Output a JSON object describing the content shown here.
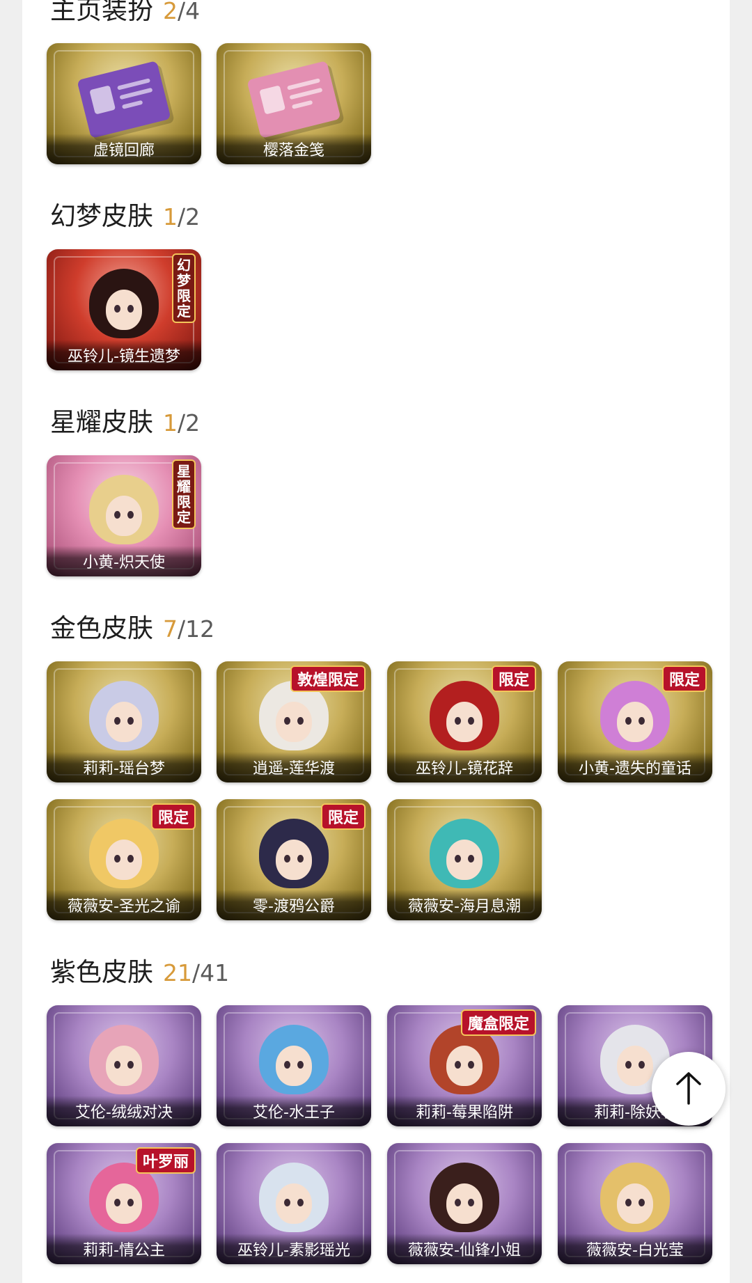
{
  "sections": [
    {
      "title": "主页装扮",
      "owned": "2",
      "separator": "/",
      "total": "4",
      "items": [
        {
          "label": "虚镜回廊",
          "theme": "gold",
          "art": "ticket",
          "art_color": "#7b4db8"
        },
        {
          "label": "樱落金笺",
          "theme": "gold",
          "art": "ticket",
          "art_color": "#e38fb2"
        }
      ]
    },
    {
      "title": "幻梦皮肤",
      "owned": "1",
      "separator": "/",
      "total": "2",
      "items": [
        {
          "label": "巫铃儿-镜生遗梦",
          "theme": "red",
          "art": "portrait",
          "hair_color": "#2a1412",
          "badge": "幻梦限定",
          "badge_style": "vertical"
        }
      ]
    },
    {
      "title": "星耀皮肤",
      "owned": "1",
      "separator": "/",
      "total": "2",
      "items": [
        {
          "label": "小黄-炽天使",
          "theme": "pink",
          "art": "portrait",
          "hair_color": "#e8cf8c",
          "badge": "星耀限定",
          "badge_style": "vertical"
        }
      ]
    },
    {
      "title": "金色皮肤",
      "owned": "7",
      "separator": "/",
      "total": "12",
      "items": [
        {
          "label": "莉莉-瑶台梦",
          "theme": "gold",
          "art": "portrait",
          "hair_color": "#c9cbe6"
        },
        {
          "label": "逍遥-莲华渡",
          "theme": "gold",
          "art": "portrait",
          "hair_color": "#ece8e2",
          "badge": "敦煌限定"
        },
        {
          "label": "巫铃儿-镜花辞",
          "theme": "gold",
          "art": "portrait",
          "hair_color": "#b31f1f",
          "badge": "限定"
        },
        {
          "label": "小黄-遗失的童话",
          "theme": "gold",
          "art": "portrait",
          "hair_color": "#cf7fd6",
          "badge": "限定"
        },
        {
          "label": "薇薇安-圣光之谕",
          "theme": "gold",
          "art": "portrait",
          "hair_color": "#f0c865",
          "badge": "限定"
        },
        {
          "label": "零-渡鸦公爵",
          "theme": "gold",
          "art": "portrait",
          "hair_color": "#2d2a4a",
          "badge": "限定"
        },
        {
          "label": "薇薇安-海月息潮",
          "theme": "gold",
          "art": "portrait",
          "hair_color": "#3fb9b5"
        }
      ]
    },
    {
      "title": "紫色皮肤",
      "owned": "21",
      "separator": "/",
      "total": "41",
      "items": [
        {
          "label": "艾伦-绒绒对决",
          "theme": "purple",
          "art": "portrait",
          "hair_color": "#e7a4b8"
        },
        {
          "label": "艾伦-水王子",
          "theme": "purple",
          "art": "portrait",
          "hair_color": "#5aa8e0"
        },
        {
          "label": "莉莉-莓果陷阱",
          "theme": "purple",
          "art": "portrait",
          "hair_color": "#b2442a",
          "badge": "魔盒限定"
        },
        {
          "label": "莉莉-除妖小",
          "theme": "purple",
          "art": "portrait",
          "hair_color": "#e4e4ea"
        },
        {
          "label": "莉莉-情公主",
          "theme": "purple",
          "art": "portrait",
          "hair_color": "#e5669a",
          "badge": "叶罗丽"
        },
        {
          "label": "巫铃儿-素影瑶光",
          "theme": "purple",
          "art": "portrait",
          "hair_color": "#d8e2ee"
        },
        {
          "label": "薇薇安-仙锋小姐",
          "theme": "purple",
          "art": "portrait",
          "hair_color": "#3a1f1c"
        },
        {
          "label": "薇薇安-白光莹",
          "theme": "purple",
          "art": "portrait",
          "hair_color": "#e4c06a"
        }
      ]
    }
  ],
  "back_to_top": {
    "icon": "arrow-up-icon"
  }
}
